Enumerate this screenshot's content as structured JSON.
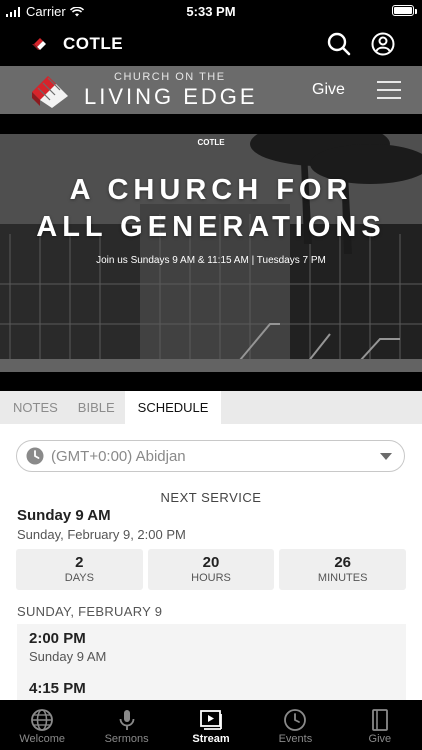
{
  "status_bar": {
    "carrier": "Carrier",
    "time": "5:33 PM"
  },
  "app_bar": {
    "title": "COTLE"
  },
  "church_header": {
    "line1": "CHURCH ON THE",
    "line2": "LIVING EDGE",
    "give_label": "Give"
  },
  "hero": {
    "tag": "COTLE",
    "title_line1": "A CHURCH FOR",
    "title_line2": "ALL GENERATIONS",
    "subtitle": "Join us Sundays 9 AM & 11:15 AM | Tuesdays 7 PM"
  },
  "tabs": [
    {
      "label": "NOTES",
      "active": false
    },
    {
      "label": "BIBLE",
      "active": false
    },
    {
      "label": "SCHEDULE",
      "active": true
    }
  ],
  "schedule": {
    "timezone": "(GMT+0:00) Abidjan",
    "next_service_label": "NEXT SERVICE",
    "next_service_name": "Sunday 9 AM",
    "next_service_date": "Sunday, February 9, 2:00 PM",
    "countdown": [
      {
        "value": "2",
        "unit": "DAYS"
      },
      {
        "value": "20",
        "unit": "HOURS"
      },
      {
        "value": "26",
        "unit": "MINUTES"
      }
    ],
    "day_header": "SUNDAY, FEBRUARY 9",
    "services": [
      {
        "time": "2:00 PM",
        "name": "Sunday 9 AM"
      },
      {
        "time": "4:15 PM",
        "name": ""
      }
    ]
  },
  "bottom_nav": [
    {
      "label": "Welcome",
      "icon": "globe-icon",
      "active": false
    },
    {
      "label": "Sermons",
      "icon": "microphone-icon",
      "active": false
    },
    {
      "label": "Stream",
      "icon": "stream-icon",
      "active": true
    },
    {
      "label": "Events",
      "icon": "clock-icon",
      "active": false
    },
    {
      "label": "Give",
      "icon": "book-icon",
      "active": false
    }
  ],
  "colors": {
    "header_gray": "#6b6b6b",
    "brand_red": "#d6242b",
    "nav_black": "#000000"
  }
}
